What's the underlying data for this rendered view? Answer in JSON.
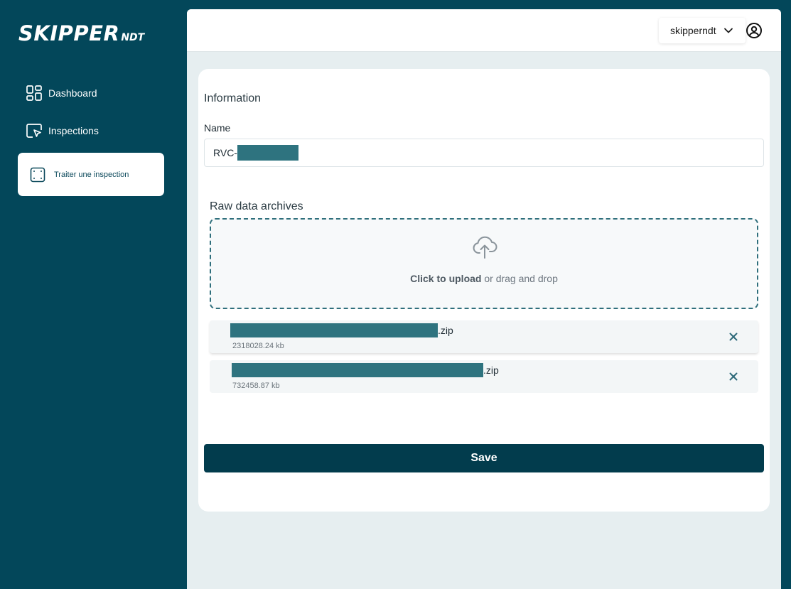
{
  "brand": {
    "logo_main": "SKIPPER",
    "logo_sub": "NDT"
  },
  "sidebar": {
    "items": [
      {
        "label": "Dashboard",
        "icon": "grid-icon",
        "active": false
      },
      {
        "label": "Inspections",
        "icon": "cursor-window-icon",
        "active": false
      },
      {
        "label": "Traiter une inspection",
        "icon": "frame-icon",
        "active": true
      }
    ]
  },
  "header": {
    "username": "skipperndt",
    "account_icon": "account-circle-icon"
  },
  "form": {
    "section_title": "Information",
    "name_label": "Name",
    "name_prefix": "RVC-",
    "archives_title": "Raw data archives",
    "dropzone": {
      "action": "Click to upload",
      "rest": " or drag and drop",
      "icon": "cloud-upload-icon"
    },
    "files": [
      {
        "extension": ".zip",
        "size": "2318028.24 kb"
      },
      {
        "extension": ".zip",
        "size": "732458.87 kb"
      }
    ],
    "save_label": "Save"
  },
  "colors": {
    "sidebar_bg": "#03475a",
    "accent": "#023c4d",
    "redaction": "#2e737f",
    "content_bg": "#e6eef0"
  }
}
